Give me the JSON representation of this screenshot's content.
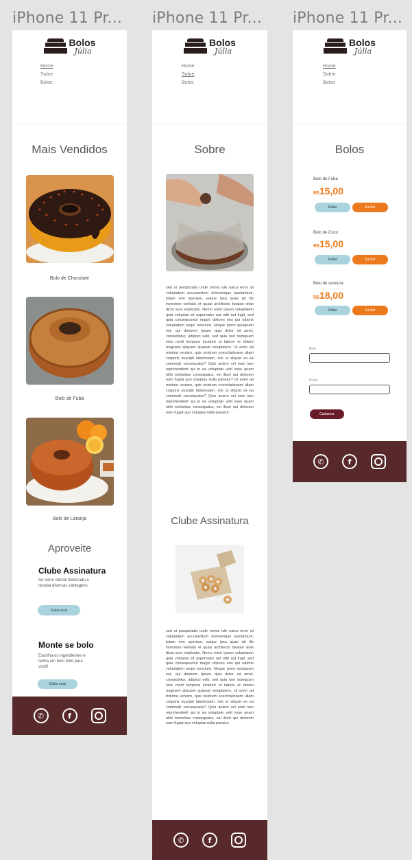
{
  "frames": [
    {
      "title": "iPhone 11 Pr..."
    },
    {
      "title": "iPhone 11 Pr..."
    },
    {
      "title": "iPhone 11 Pr..."
    }
  ],
  "logo": {
    "line1": "Bolos",
    "line2": "Júlia"
  },
  "nav": [
    "Home",
    "Sobre",
    "Bolos"
  ],
  "home": {
    "section_title": "Mais Vendidos",
    "products": [
      {
        "name": "Bolo de Chocolate"
      },
      {
        "name": "Bolo de Fubá"
      },
      {
        "name": "Bolo de Laranja"
      }
    ],
    "promo_title": "Aproveite",
    "cards": [
      {
        "title": "Clube Assinatura",
        "text": "Se torne cliente fidelizado e receba diversas vantagens",
        "button": "Saiba mais"
      },
      {
        "title": "Monte se bolo",
        "text": "Escolha os ingredientes e tenha um bolo feito para você!",
        "button": "Saiba mais"
      }
    ]
  },
  "sobre": {
    "title": "Sobre",
    "paragraph": "sed ut perspiciatis unde omnis iste natus error sit voluptatem accusantium doloremque laudantium, totam rem aperiam, eaque ipsa quae ab illo inventore veritatis et quasi architecto beatae vitae dicta sunt explicabo. Nemo enim ipsam voluptatem quia voluptas sit aspernatur aut odit aut fugit, sed quia consequuntur magni dolores eos qui ratione voluptatem sequi nesciunt. Neque porro quisquam est, qui dolorem ipsum quia dolor sit amet, consectetur, adipisci velit, sed quia non numquam eius modi tempora incidunt ut labore et dolore magnam aliquam quaerat voluptatem. Ut enim ad minima veniam, quis nostrum exercitationem ullam corporis suscipit laboriosam, nisi ut aliquid ex ea commodi consequatur? Quis autem vel eum iure reprehenderit qui in ea voluptate velit esse quam nihil molestiae consequatur, vel illum qui dolorem eum fugiat quo voluptas nulla pariatur? Ut enim ad minima veniam, quis nostrum exercitationem ullam corporis suscipit laboriosam, nisi ut aliquid ex ea commodi consequatur? Quis autem vel eum iure reprehenderit qui in ea voluptate velit esse quam nihil molestiae consequatur, vel illum qui dolorem eum fugiat quo voluptas nulla pariatur.",
    "club_title": "Clube Assinatura",
    "club_paragraph": "sed ut perspiciatis unde omnis iste natus error sit voluptatem accusantium doloremque laudantium, totam rem aperiam, eaque ipsa quae ab illo inventore veritatis et quasi architecto beatae vitae dicta sunt explicabo. Nemo enim ipsam voluptatem quia voluptas sit aspernatur aut odit aut fugit, sed quia consequuntur magni dolores eos qui ratione voluptatem sequi nesciunt. Neque porro quisquam est, qui dolorem ipsum quia dolor sit amet, consectetur, adipisci velit, sed quia non numquam eius modi tempora incidunt ut labore et dolore magnam aliquam quaerat voluptatem. Ut enim ad minima veniam, quis nostrum exercitationem ullam corporis suscipit laboriosam, nisi ut aliquid ex ea commodi consequatur? Quis autem vel eum iure reprehenderit qui in ea voluptate velit esse quam nihil molestiae consequatur, vel illum qui dolorem eum fugiat quo voluptas nulla pariatur."
  },
  "bolos": {
    "title": "Bolos",
    "items": [
      {
        "name": "Bolo de Fubá",
        "currency": "R$",
        "price": "15,00",
        "edit": "Editar",
        "delete": "Excluir"
      },
      {
        "name": "Bolo de Coco",
        "currency": "R$",
        "price": "15,00",
        "edit": "Editar",
        "delete": "Excluir"
      },
      {
        "name": "Bolo de cenoura",
        "currency": "R$",
        "price": "18,00",
        "edit": "Editar",
        "delete": "Excluir"
      }
    ],
    "form": {
      "label1": "Bolo",
      "label2": "Preço",
      "submit": "Cadastrar"
    }
  },
  "footer_icons": [
    "whatsapp-icon",
    "facebook-icon",
    "instagram-icon"
  ],
  "colors": {
    "footer": "#58292a",
    "accent_orange": "#ec7a1c",
    "accent_blue": "#a9d3dd",
    "maroon": "#6a1b2a"
  }
}
